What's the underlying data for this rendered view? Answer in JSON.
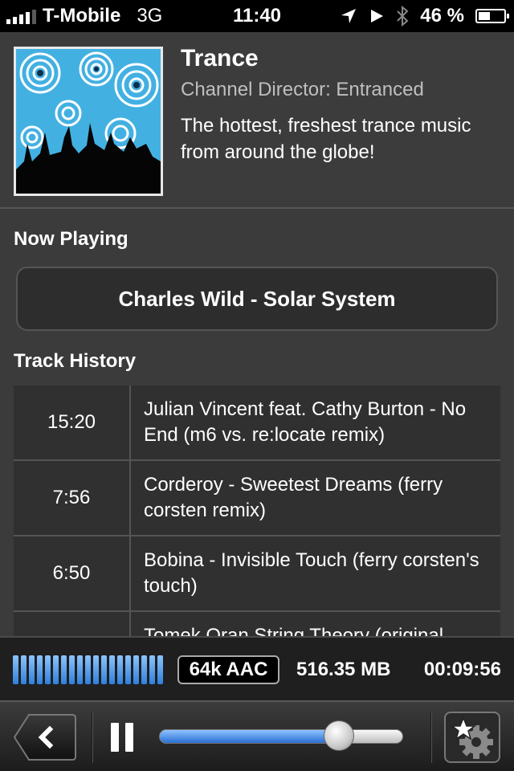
{
  "status_bar": {
    "carrier": "T-Mobile",
    "network": "3G",
    "time": "11:40",
    "battery": "46 %",
    "battery_level": 0.46,
    "icons": [
      "signal-bars-icon",
      "location-arrow-icon",
      "play-triangle-icon",
      "bluetooth-icon",
      "battery-icon"
    ]
  },
  "channel": {
    "title": "Trance",
    "director": "Channel Director: Entranced",
    "description": "The hottest, freshest trance music from around the globe!"
  },
  "now_playing": {
    "label": "Now Playing",
    "track": "Charles Wild - Solar System"
  },
  "history": {
    "label": "Track History",
    "rows": [
      {
        "time": "15:20",
        "track": "Julian Vincent feat. Cathy Burton - No End (m6 vs. re:locate remix)"
      },
      {
        "time": "7:56",
        "track": "Corderoy - Sweetest Dreams (ferry corsten remix)"
      },
      {
        "time": "6:50",
        "track": "Bobina - Invisible Touch (ferry corsten's touch)"
      },
      {
        "time": "",
        "track": "Tomek Oran String Theory (original"
      }
    ]
  },
  "info_bar": {
    "format": "64k AAC",
    "data_used": "516.35 MB",
    "elapsed": "00:09:56"
  },
  "controls": {
    "volume_level": 0.74,
    "icons": [
      "back-chevron-icon",
      "pause-icon",
      "volume-slider",
      "star-gear-settings-icon"
    ]
  },
  "colors": {
    "accent_blue": "#2f7fdb",
    "background": "#3b3b3b"
  }
}
